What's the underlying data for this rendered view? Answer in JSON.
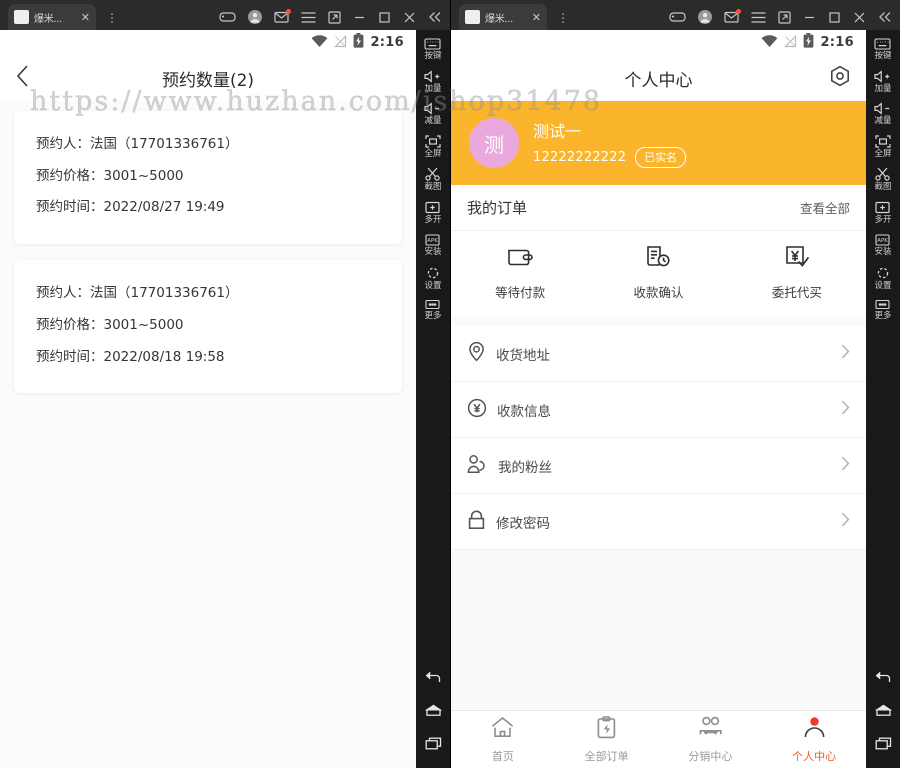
{
  "window": {
    "tab_title": "爆米...",
    "tab_close": "✕",
    "overflow_menu": "⋮",
    "icons": [
      "gamepad-icon",
      "account-icon",
      "mail-icon",
      "menu-icon",
      "restore-icon",
      "minimize-icon",
      "maximize-icon",
      "close-icon",
      "collapse-icon"
    ]
  },
  "watermark": {
    "text": "https://www.huzhan.com/ishop31478"
  },
  "status_bar": {
    "time": "2:16",
    "icons": [
      "wifi-icon",
      "signal-off-icon",
      "battery-charging-icon"
    ]
  },
  "left_app": {
    "header": {
      "back": "‹",
      "title": "预约数量(2)"
    },
    "labels": {
      "person": "预约人：",
      "price": "预约价格：",
      "time": "预约时间："
    },
    "cards": [
      {
        "person": "法国（17701336761）",
        "price": "3001~5000",
        "time": "2022/08/27 19:49"
      },
      {
        "person": "法国（17701336761）",
        "price": "3001~5000",
        "time": "2022/08/18 19:58"
      }
    ]
  },
  "right_app": {
    "header": {
      "title": "个人中心",
      "settings_icon": "gear-icon"
    },
    "profile": {
      "avatar_initial": "测",
      "name": "测试一",
      "phone": "12222222222",
      "badge": "已实名",
      "bg_color": "#fbb52c",
      "avatar_color": "#e9a9dd"
    },
    "orders": {
      "title": "我的订单",
      "view_all": "查看全部"
    },
    "actions": [
      {
        "label": "等待付款",
        "icon": "wallet-icon"
      },
      {
        "label": "收款确认",
        "icon": "document-clock-icon"
      },
      {
        "label": "委托代买",
        "icon": "yen-check-icon"
      }
    ],
    "menu": [
      {
        "label": "收货地址",
        "icon": "location-pin-icon"
      },
      {
        "label": "收款信息",
        "icon": "yen-circle-icon"
      },
      {
        "label": "我的粉丝",
        "icon": "people-icon"
      },
      {
        "label": "修改密码",
        "icon": "lock-icon"
      }
    ],
    "tabbar": {
      "active_color": "#f05a28",
      "items": [
        {
          "label": "首页",
          "icon": "home-icon",
          "active": false
        },
        {
          "label": "全部订单",
          "icon": "clipboard-icon",
          "active": false
        },
        {
          "label": "分销中心",
          "icon": "distribution-icon",
          "active": false
        },
        {
          "label": "个人中心",
          "icon": "person-icon",
          "active": true
        }
      ]
    }
  },
  "emulator_toolbar": {
    "items": [
      {
        "label": "按键",
        "icon": "keyboard-icon"
      },
      {
        "label": "加量",
        "icon": "volume-up-icon"
      },
      {
        "label": "减量",
        "icon": "volume-down-icon"
      },
      {
        "label": "全屏",
        "icon": "fullscreen-icon"
      },
      {
        "label": "截图",
        "icon": "scissors-icon"
      },
      {
        "label": "多开",
        "icon": "multi-instance-icon"
      },
      {
        "label": "安装",
        "icon": "apk-install-icon"
      },
      {
        "label": "设置",
        "icon": "settings-icon"
      },
      {
        "label": "更多",
        "icon": "more-icon"
      }
    ],
    "nav": [
      "back-icon",
      "home-icon",
      "recents-icon"
    ]
  }
}
